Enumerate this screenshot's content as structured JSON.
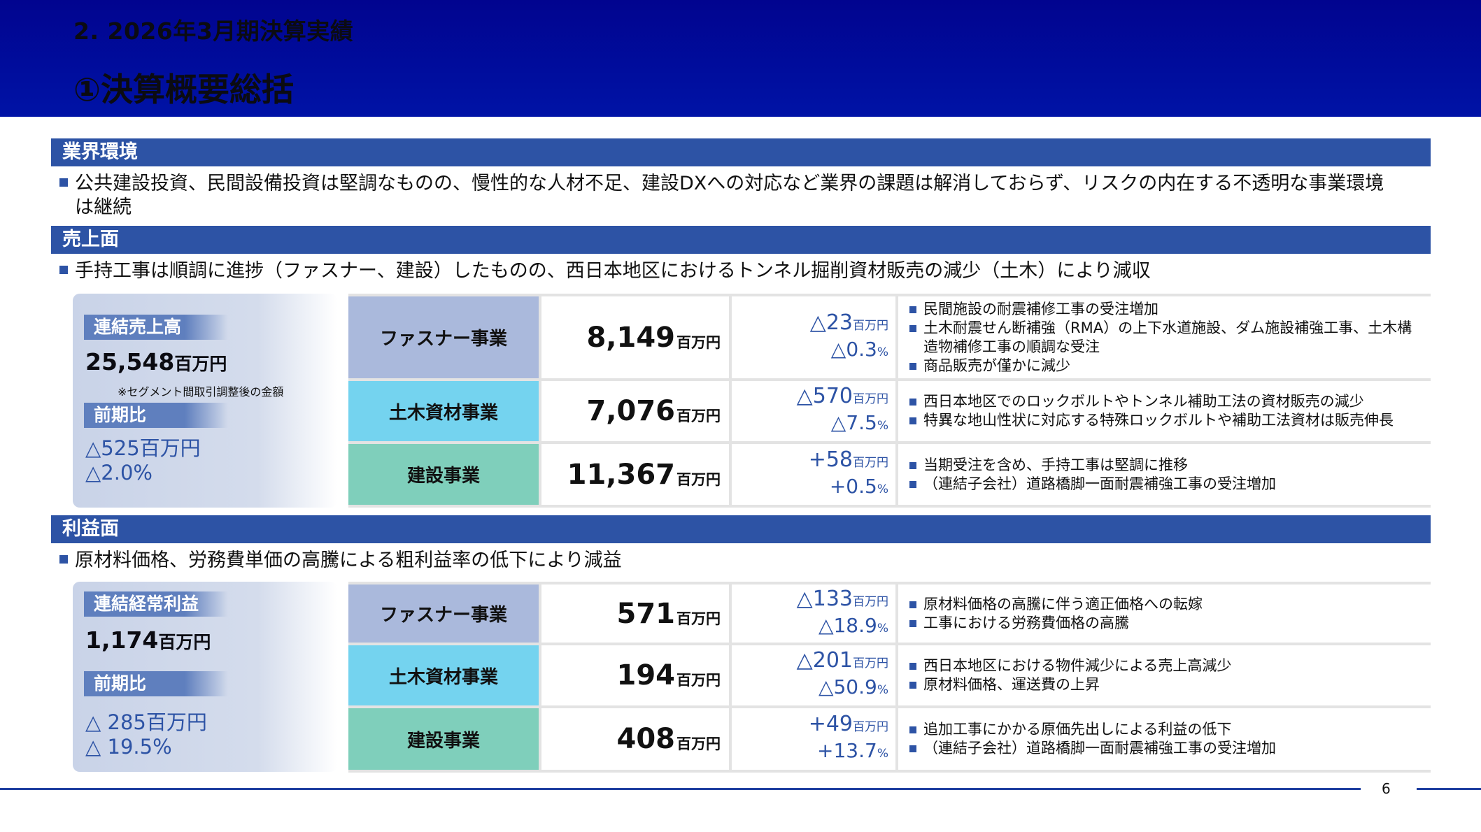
{
  "header": {
    "chapter": "2. 2026年3月期決算実績",
    "title": "①決算概要総括"
  },
  "industry": {
    "title": "業界環境",
    "line1": "公共建設投資、民間設備投資は堅調なものの、慢性的な人材不足、建設DXへの対応など業界の課題は解消しておらず、リスクの内在する不透明な事業環境",
    "line2": "は継続"
  },
  "sales": {
    "title": "売上面",
    "summary": "手持工事は順調に進捗（ファスナー、建設）したものの、西日本地区におけるトンネル掘削資材販売の減少（土木）により減収",
    "panel": {
      "label": "連結売上高",
      "value": "25,548",
      "unit": "百万円",
      "note": "※セグメント間取引調整後の金額",
      "yoy_label": "前期比",
      "yoy1": "△525百万円",
      "yoy2": "△2.0%"
    },
    "rows": [
      {
        "segment": "ファスナー事業",
        "value": "8,149",
        "unit": "百万円",
        "chg_amount": "△23",
        "chg_unit": "百万円",
        "chg_pct": "△0.3",
        "pct_unit": "%",
        "notes": [
          "民間施設の耐震補修工事の受注増加",
          "土木耐震せん断補強（RMA）の上下水道施設、ダム施設補強工事、土木構造物補修工事の順調な受注",
          "商品販売が僅かに減少"
        ]
      },
      {
        "segment": "土木資材事業",
        "value": "7,076",
        "unit": "百万円",
        "chg_amount": "△570",
        "chg_unit": "百万円",
        "chg_pct": "△7.5",
        "pct_unit": "%",
        "notes": [
          "西日本地区でのロックボルトやトンネル補助工法の資材販売の減少",
          "特異な地山性状に対応する特殊ロックボルトや補助工法資材は販売伸長"
        ]
      },
      {
        "segment": "建設事業",
        "value": "11,367",
        "unit": "百万円",
        "chg_amount": "+58",
        "chg_unit": "百万円",
        "chg_pct": "+0.5",
        "pct_unit": "%",
        "notes": [
          "当期受注を含め、手持工事は堅調に推移",
          "（連結子会社）道路橋脚一面耐震補強工事の受注増加"
        ]
      }
    ]
  },
  "profit": {
    "title": "利益面",
    "summary": "原材料価格、労務費単価の高騰による粗利益率の低下により減益",
    "panel": {
      "label": "連結経常利益",
      "value": "1,174",
      "unit": "百万円",
      "yoy_label": "前期比",
      "yoy1": "△ 285百万円",
      "yoy2": "△ 19.5%"
    },
    "rows": [
      {
        "segment": "ファスナー事業",
        "value": "571",
        "unit": "百万円",
        "chg_amount": "△133",
        "chg_unit": "百万円",
        "chg_pct": "△18.9",
        "pct_unit": "%",
        "notes": [
          "原材料価格の高騰に伴う適正価格への転嫁",
          "工事における労務費価格の高騰"
        ]
      },
      {
        "segment": "土木資材事業",
        "value": "194",
        "unit": "百万円",
        "chg_amount": "△201",
        "chg_unit": "百万円",
        "chg_pct": "△50.9",
        "pct_unit": "%",
        "notes": [
          "西日本地区における物件減少による売上高減少",
          "原材料価格、運送費の上昇"
        ]
      },
      {
        "segment": "建設事業",
        "value": "408",
        "unit": "百万円",
        "chg_amount": "+49",
        "chg_unit": "百万円",
        "chg_pct": "+13.7",
        "pct_unit": "%",
        "notes": [
          "追加工事にかかる原価先出しによる利益の低下",
          "（連結子会社）道路橋脚一面耐震補強工事の受注増加"
        ]
      }
    ]
  },
  "footer": {
    "page": "6"
  },
  "colors": {
    "header": "#01048f",
    "section_bar": "#2d53a5",
    "fastener": "#aab9dc",
    "civil": "#74d3ef",
    "construction": "#7fcfbb"
  }
}
